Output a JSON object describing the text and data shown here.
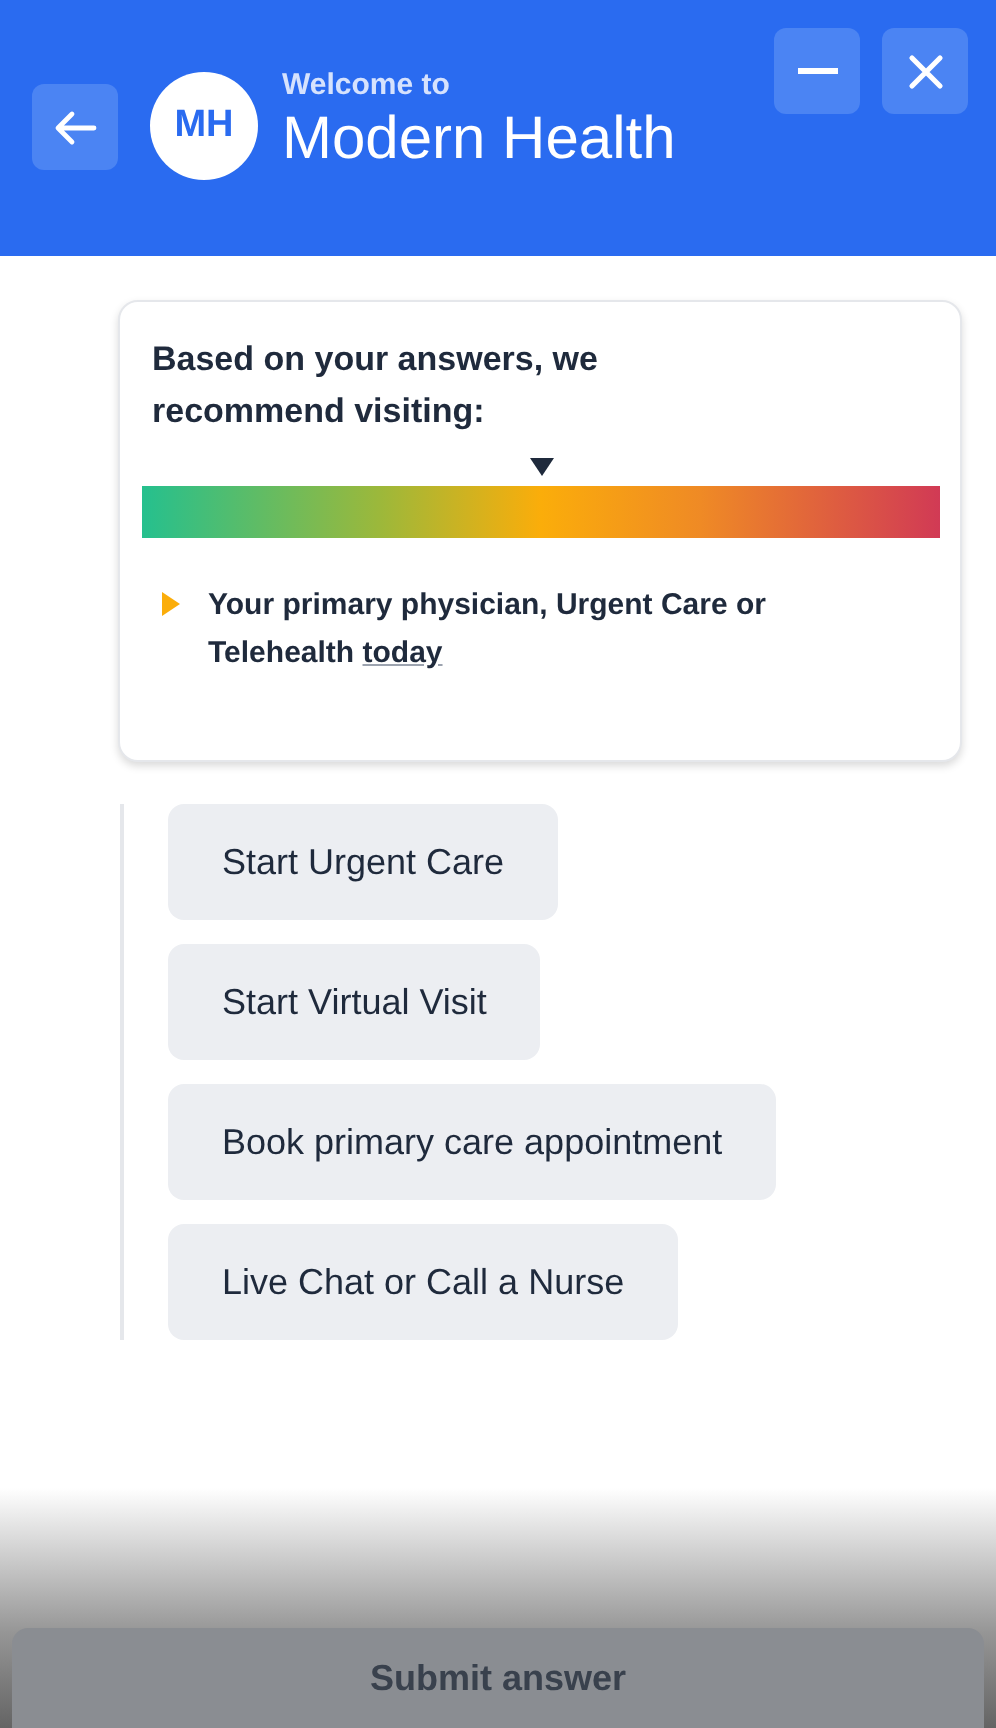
{
  "header": {
    "subtitle": "Welcome to",
    "title": "Modern Health",
    "avatar": "MH"
  },
  "recommendation": {
    "heading": "Based on your answers, we recommend visiting:",
    "level": 0.5,
    "text": "Your primary physician, Urgent Care or Telehealth",
    "link": "today"
  },
  "options": [
    {
      "label": "Start Urgent Care"
    },
    {
      "label": "Start Virtual Visit"
    },
    {
      "label": "Book primary care appointment"
    },
    {
      "label": "Live Chat or Call a Nurse"
    }
  ],
  "submit": {
    "label": "Submit answer",
    "disabled": true
  }
}
